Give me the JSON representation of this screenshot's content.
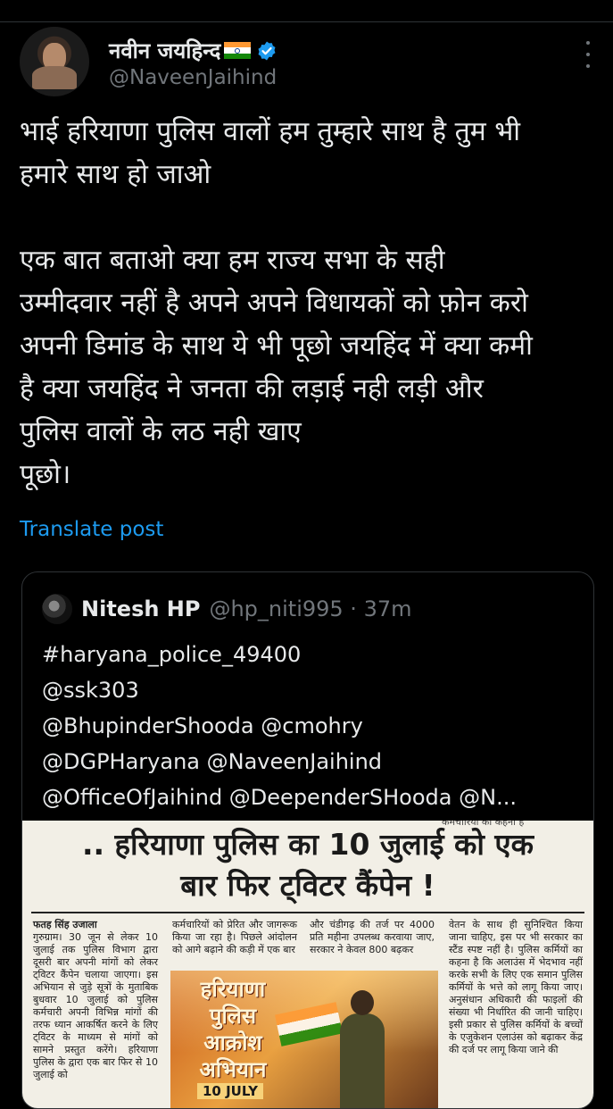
{
  "tweet": {
    "display_name": "नवीन जयहिन्द",
    "handle": "@NaveenJaihind",
    "text": "भाई हरियाणा पुलिस वालों हम तुम्हारे साथ है तुम भी\nहमारे साथ हो जाओ\n\nएक बात बताओ क्या हम राज्य सभा के सही\nउम्मीदवार नहीं है अपने अपने विधायकों को फ़ोन करो\nअपनी डिमांड के साथ ये भी पूछो जयहिंद में क्या कमी\nहै क्या जयहिंद ने जनता की लड़ाई नही लड़ी और\nपुलिस वालों के लठ नही खाए\nपूछो।",
    "translate_label": "Translate post"
  },
  "quote": {
    "name": "Nitesh HP",
    "handle_time": "@hp_niti995 · 37m",
    "text": "#haryana_police_49400\n@ssk303\n@BhupinderShooda @cmohry\n@DGPHaryana @NaveenJaihind\n@OfficeOfJaihind @DeependerSHooda @N..."
  },
  "clipping": {
    "headline": ".. हरियाणा पुलिस का 10 जुलाई को एक\nबार फिर ट्विटर कैंपेन !",
    "byline": "फतह सिंह उजाला",
    "col1": "गुरुग्राम। 30 जून से लेकर 10 जुलाई तक पुलिस विभाग द्वारा दूसरी बार अपनी मांगों को लेकर ट्विटर कैंपेन चलाया जाएगा। इस अभियान से जुड़े सूत्रों के मुताबिक बुधवार 10 जुलाई को पुलिस कर्मचारी अपनी विभिन्न मांगों की तरफ ध्यान आकर्षित करने के लिए ट्विटर के माध्यम से मांगों को सामने प्रस्तुत करेंगे। हरियाणा पुलिस के द्वारा एक बार फिर से 10 जुलाई को",
    "col2": "कर्मचारियों को प्रेरित और जागरूक किया जा रहा है। पिछले आंदोलन को आगे बढ़ाने की कड़ी में एक बार",
    "col3": "और चंडीगढ़ की तर्ज पर 4000 प्रति महीना उपलब्ध करवाया जाए, सरकार ने केवल 800 बढ़कर",
    "col4": "वेतन के साथ ही सुनिश्चित किया जाना चाहिए, इस पर भी सरकार का स्टैंड स्पष्ट नहीं है। पुलिस कर्मियों का कहना है कि अलाउंस में भेदभाव नहीं करके सभी के लिए एक समान पुलिस कर्मियों के भत्ते को लागू किया जाए। अनुसंधान अधिकारी की फाइलों की संख्या भी निर्धारित की जानी चाहिए। इसी प्रकार से पुलिस कर्मियों के बच्चों के एजुकेशन एलाउंस को बढ़ाकर केंद्र की दर्ज पर लागू किया जाने की",
    "top_fragment": "कर्मचारियों का कहना है",
    "poster_title": "हरियाणा\nपुलिस\nआक्रोश\nअभियान",
    "poster_date": "10 JULY"
  },
  "colors": {
    "background": "#000000",
    "text": "#e7e9ea",
    "secondary": "#71767b",
    "link": "#1d9bf0",
    "border": "#2f3336"
  }
}
